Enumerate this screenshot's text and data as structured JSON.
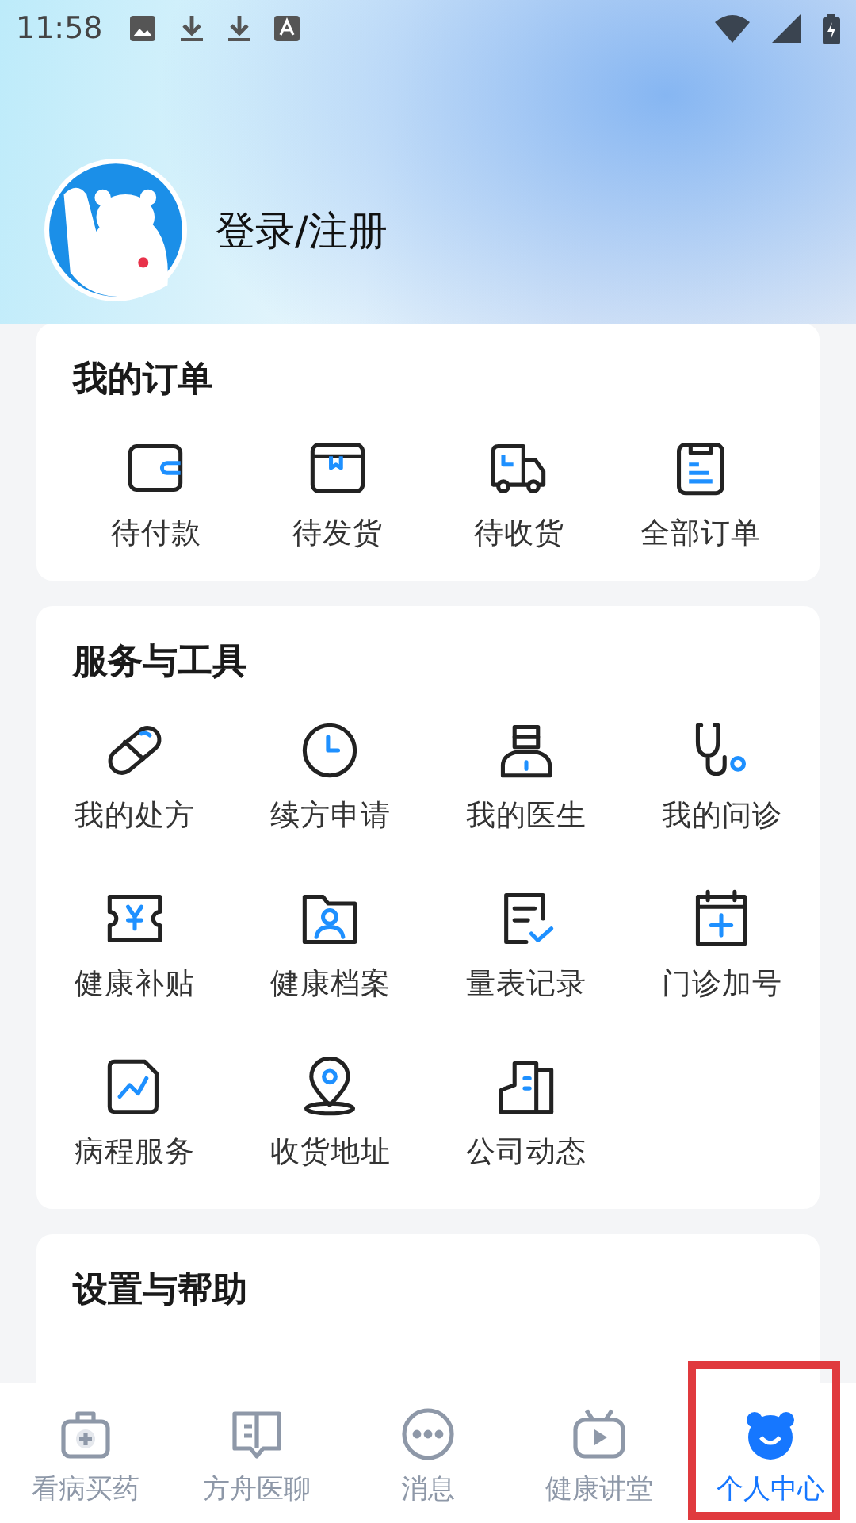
{
  "status_bar": {
    "time": "11:58"
  },
  "profile": {
    "login_label": "登录/注册"
  },
  "orders": {
    "title": "我的订单",
    "items": [
      {
        "label": "待付款"
      },
      {
        "label": "待发货"
      },
      {
        "label": "待收货"
      },
      {
        "label": "全部订单"
      }
    ]
  },
  "services": {
    "title": "服务与工具",
    "items": [
      {
        "label": "我的处方"
      },
      {
        "label": "续方申请"
      },
      {
        "label": "我的医生"
      },
      {
        "label": "我的问诊"
      },
      {
        "label": "健康补贴"
      },
      {
        "label": "健康档案"
      },
      {
        "label": "量表记录"
      },
      {
        "label": "门诊加号"
      },
      {
        "label": "病程服务"
      },
      {
        "label": "收货地址"
      },
      {
        "label": "公司动态"
      }
    ]
  },
  "settings": {
    "title": "设置与帮助"
  },
  "tabs": [
    {
      "label": "看病买药",
      "selected": false,
      "highlighted": false
    },
    {
      "label": "方舟医聊",
      "selected": false,
      "highlighted": false
    },
    {
      "label": "消息",
      "selected": false,
      "highlighted": false
    },
    {
      "label": "健康讲堂",
      "selected": false,
      "highlighted": false
    },
    {
      "label": "个人中心",
      "selected": true,
      "highlighted": true
    }
  ]
}
